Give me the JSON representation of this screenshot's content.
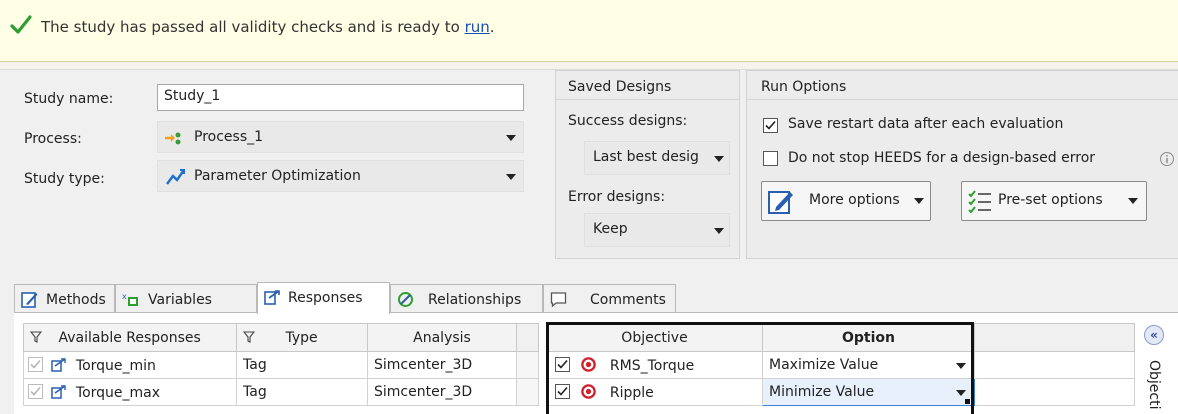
{
  "banner": {
    "message": "The study has passed all validity checks and is ready to ",
    "link": "run",
    "suffix": ".",
    "status_icon": "check-icon"
  },
  "study": {
    "name_label": "Study name:",
    "name_value": "Study_1",
    "process_label": "Process:",
    "process_value": "Process_1",
    "process_icon": "process-icon",
    "type_label": "Study type:",
    "type_value": "Parameter Optimization",
    "type_icon": "optimization-icon"
  },
  "saved_designs": {
    "title": "Saved Designs",
    "success_label": "Success designs:",
    "success_value": "Last best desig",
    "error_label": "Error designs:",
    "error_value": "Keep"
  },
  "run_options": {
    "title": "Run Options",
    "save_restart_label": "Save restart data after each evaluation",
    "save_restart_checked": true,
    "do_not_stop_label": "Do not stop HEEDS for a design-based error",
    "do_not_stop_checked": false,
    "more_options_label": "More options",
    "preset_options_label": "Pre-set options",
    "info_icon": "info-icon"
  },
  "tabs": [
    {
      "label": "Methods",
      "icon": "methods-icon",
      "active": false
    },
    {
      "label": "Variables",
      "icon": "variables-icon",
      "active": false
    },
    {
      "label": "Responses",
      "icon": "responses-icon",
      "active": true
    },
    {
      "label": "Relationships",
      "icon": "relationships-icon",
      "active": false
    },
    {
      "label": "Comments",
      "icon": "comments-icon",
      "active": false
    }
  ],
  "responses_table": {
    "headers": [
      "Available Responses",
      "Type",
      "Analysis"
    ],
    "rows": [
      {
        "name": "Torque_min",
        "type": "Tag",
        "analysis": "Simcenter_3D"
      },
      {
        "name": "Torque_max",
        "type": "Tag",
        "analysis": "Simcenter_3D"
      }
    ]
  },
  "objectives_table": {
    "headers": [
      "Objective",
      "Option"
    ],
    "rows": [
      {
        "checked": true,
        "objective": "RMS_Torque",
        "option": "Maximize Value"
      },
      {
        "checked": true,
        "objective": "Ripple",
        "option": "Minimize Value"
      }
    ]
  },
  "side_panel": {
    "label": "Objecti",
    "collapse_icon": "collapse-left-icon",
    "collapse_glyph": "«"
  },
  "colors": {
    "banner_bg": "#ffffe6",
    "check_green": "#2e9e2e",
    "link_blue": "#1a4fb5",
    "objective_red": "#d0202a"
  }
}
